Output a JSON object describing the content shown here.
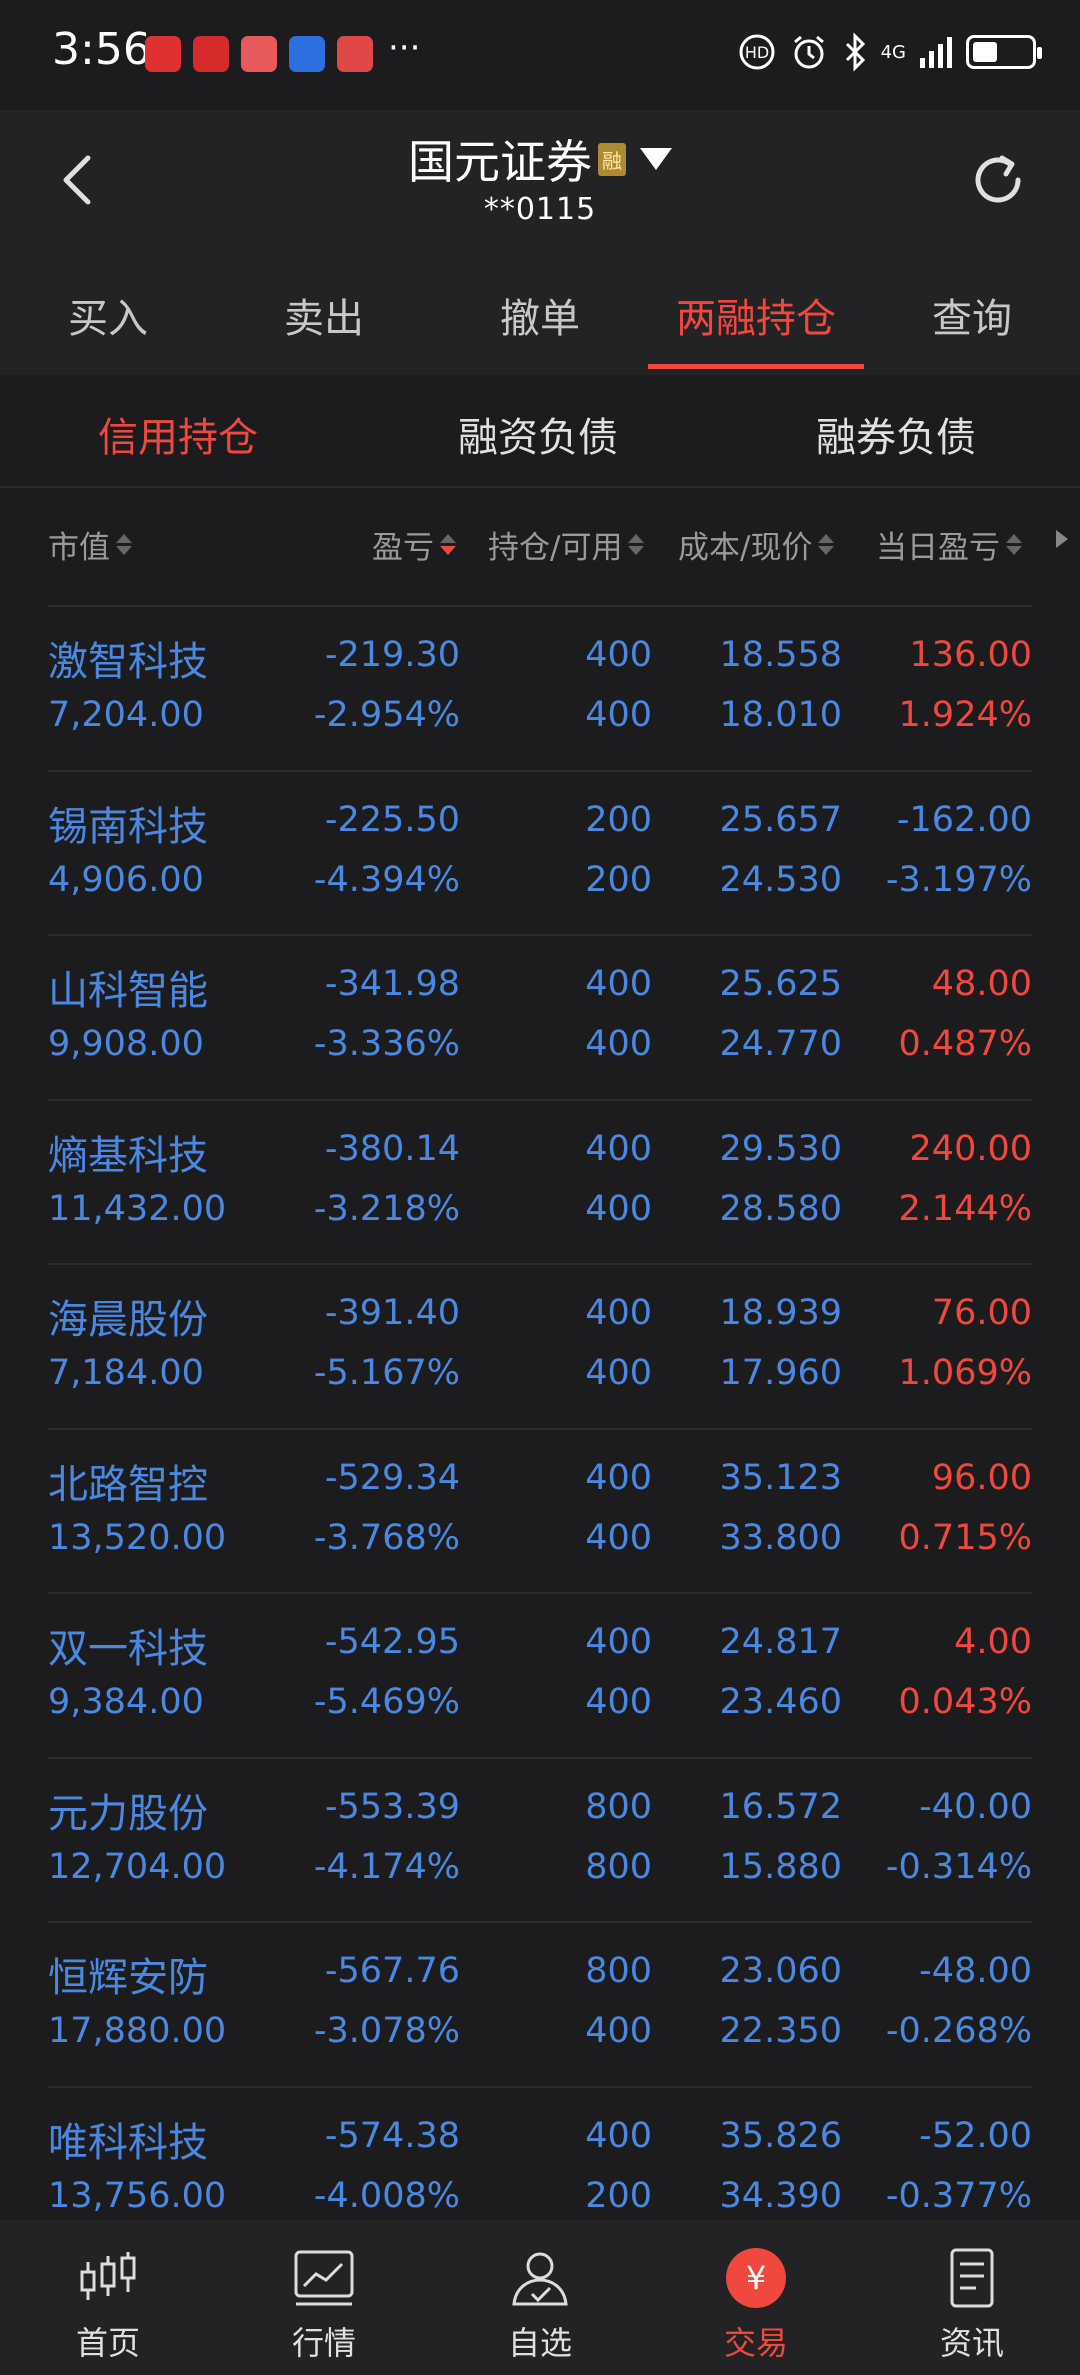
{
  "status_bar": {
    "time": "3:56",
    "more": "···",
    "network": "4G"
  },
  "header": {
    "title": "国元证券",
    "badge": "融",
    "account": "**0115"
  },
  "main_tabs": [
    {
      "label": "买入",
      "active": false
    },
    {
      "label": "卖出",
      "active": false
    },
    {
      "label": "撤单",
      "active": false
    },
    {
      "label": "两融持仓",
      "active": true
    },
    {
      "label": "查询",
      "active": false
    }
  ],
  "sub_tabs": [
    {
      "label": "信用持仓",
      "active": true
    },
    {
      "label": "融资负债",
      "active": false
    },
    {
      "label": "融券负债",
      "active": false
    }
  ],
  "columns": {
    "market_value": "市值",
    "pnl": "盈亏",
    "position": "持仓/可用",
    "price": "成本/现价",
    "day_pnl": "当日盈亏"
  },
  "positions": [
    {
      "name": "激智科技",
      "market_value": "7,204.00",
      "pnl": "-219.30",
      "pnl_pct": "-2.954%",
      "qty": "400",
      "avail": "400",
      "cost": "18.558",
      "price": "18.010",
      "day_pnl": "136.00",
      "day_pct": "1.924%",
      "dir": "up"
    },
    {
      "name": "锡南科技",
      "market_value": "4,906.00",
      "pnl": "-225.50",
      "pnl_pct": "-4.394%",
      "qty": "200",
      "avail": "200",
      "cost": "25.657",
      "price": "24.530",
      "day_pnl": "-162.00",
      "day_pct": "-3.197%",
      "dir": "down"
    },
    {
      "name": "山科智能",
      "market_value": "9,908.00",
      "pnl": "-341.98",
      "pnl_pct": "-3.336%",
      "qty": "400",
      "avail": "400",
      "cost": "25.625",
      "price": "24.770",
      "day_pnl": "48.00",
      "day_pct": "0.487%",
      "dir": "up"
    },
    {
      "name": "熵基科技",
      "market_value": "11,432.00",
      "pnl": "-380.14",
      "pnl_pct": "-3.218%",
      "qty": "400",
      "avail": "400",
      "cost": "29.530",
      "price": "28.580",
      "day_pnl": "240.00",
      "day_pct": "2.144%",
      "dir": "up"
    },
    {
      "name": "海晨股份",
      "market_value": "7,184.00",
      "pnl": "-391.40",
      "pnl_pct": "-5.167%",
      "qty": "400",
      "avail": "400",
      "cost": "18.939",
      "price": "17.960",
      "day_pnl": "76.00",
      "day_pct": "1.069%",
      "dir": "up"
    },
    {
      "name": "北路智控",
      "market_value": "13,520.00",
      "pnl": "-529.34",
      "pnl_pct": "-3.768%",
      "qty": "400",
      "avail": "400",
      "cost": "35.123",
      "price": "33.800",
      "day_pnl": "96.00",
      "day_pct": "0.715%",
      "dir": "up"
    },
    {
      "name": "双一科技",
      "market_value": "9,384.00",
      "pnl": "-542.95",
      "pnl_pct": "-5.469%",
      "qty": "400",
      "avail": "400",
      "cost": "24.817",
      "price": "23.460",
      "day_pnl": "4.00",
      "day_pct": "0.043%",
      "dir": "up"
    },
    {
      "name": "元力股份",
      "market_value": "12,704.00",
      "pnl": "-553.39",
      "pnl_pct": "-4.174%",
      "qty": "800",
      "avail": "800",
      "cost": "16.572",
      "price": "15.880",
      "day_pnl": "-40.00",
      "day_pct": "-0.314%",
      "dir": "down"
    },
    {
      "name": "恒辉安防",
      "market_value": "17,880.00",
      "pnl": "-567.76",
      "pnl_pct": "-3.078%",
      "qty": "800",
      "avail": "400",
      "cost": "23.060",
      "price": "22.350",
      "day_pnl": "-48.00",
      "day_pct": "-0.268%",
      "dir": "down"
    },
    {
      "name": "唯科科技",
      "market_value": "13,756.00",
      "pnl": "-574.38",
      "pnl_pct": "-4.008%",
      "qty": "400",
      "avail": "200",
      "cost": "35.826",
      "price": "34.390",
      "day_pnl": "-52.00",
      "day_pct": "-0.377%",
      "dir": "down"
    }
  ],
  "bottom_nav": [
    {
      "label": "首页",
      "icon": "candlestick-icon",
      "active": false
    },
    {
      "label": "行情",
      "icon": "chart-icon",
      "active": false
    },
    {
      "label": "自选",
      "icon": "user-check-icon",
      "active": false
    },
    {
      "label": "交易",
      "icon": "yuan-icon",
      "glyph": "¥",
      "active": true
    },
    {
      "label": "资讯",
      "icon": "document-icon",
      "active": false
    }
  ],
  "colors": {
    "up": "#f0483e",
    "down": "#4a88e2",
    "accent": "#f0483e",
    "background": "#1c1c1e"
  }
}
